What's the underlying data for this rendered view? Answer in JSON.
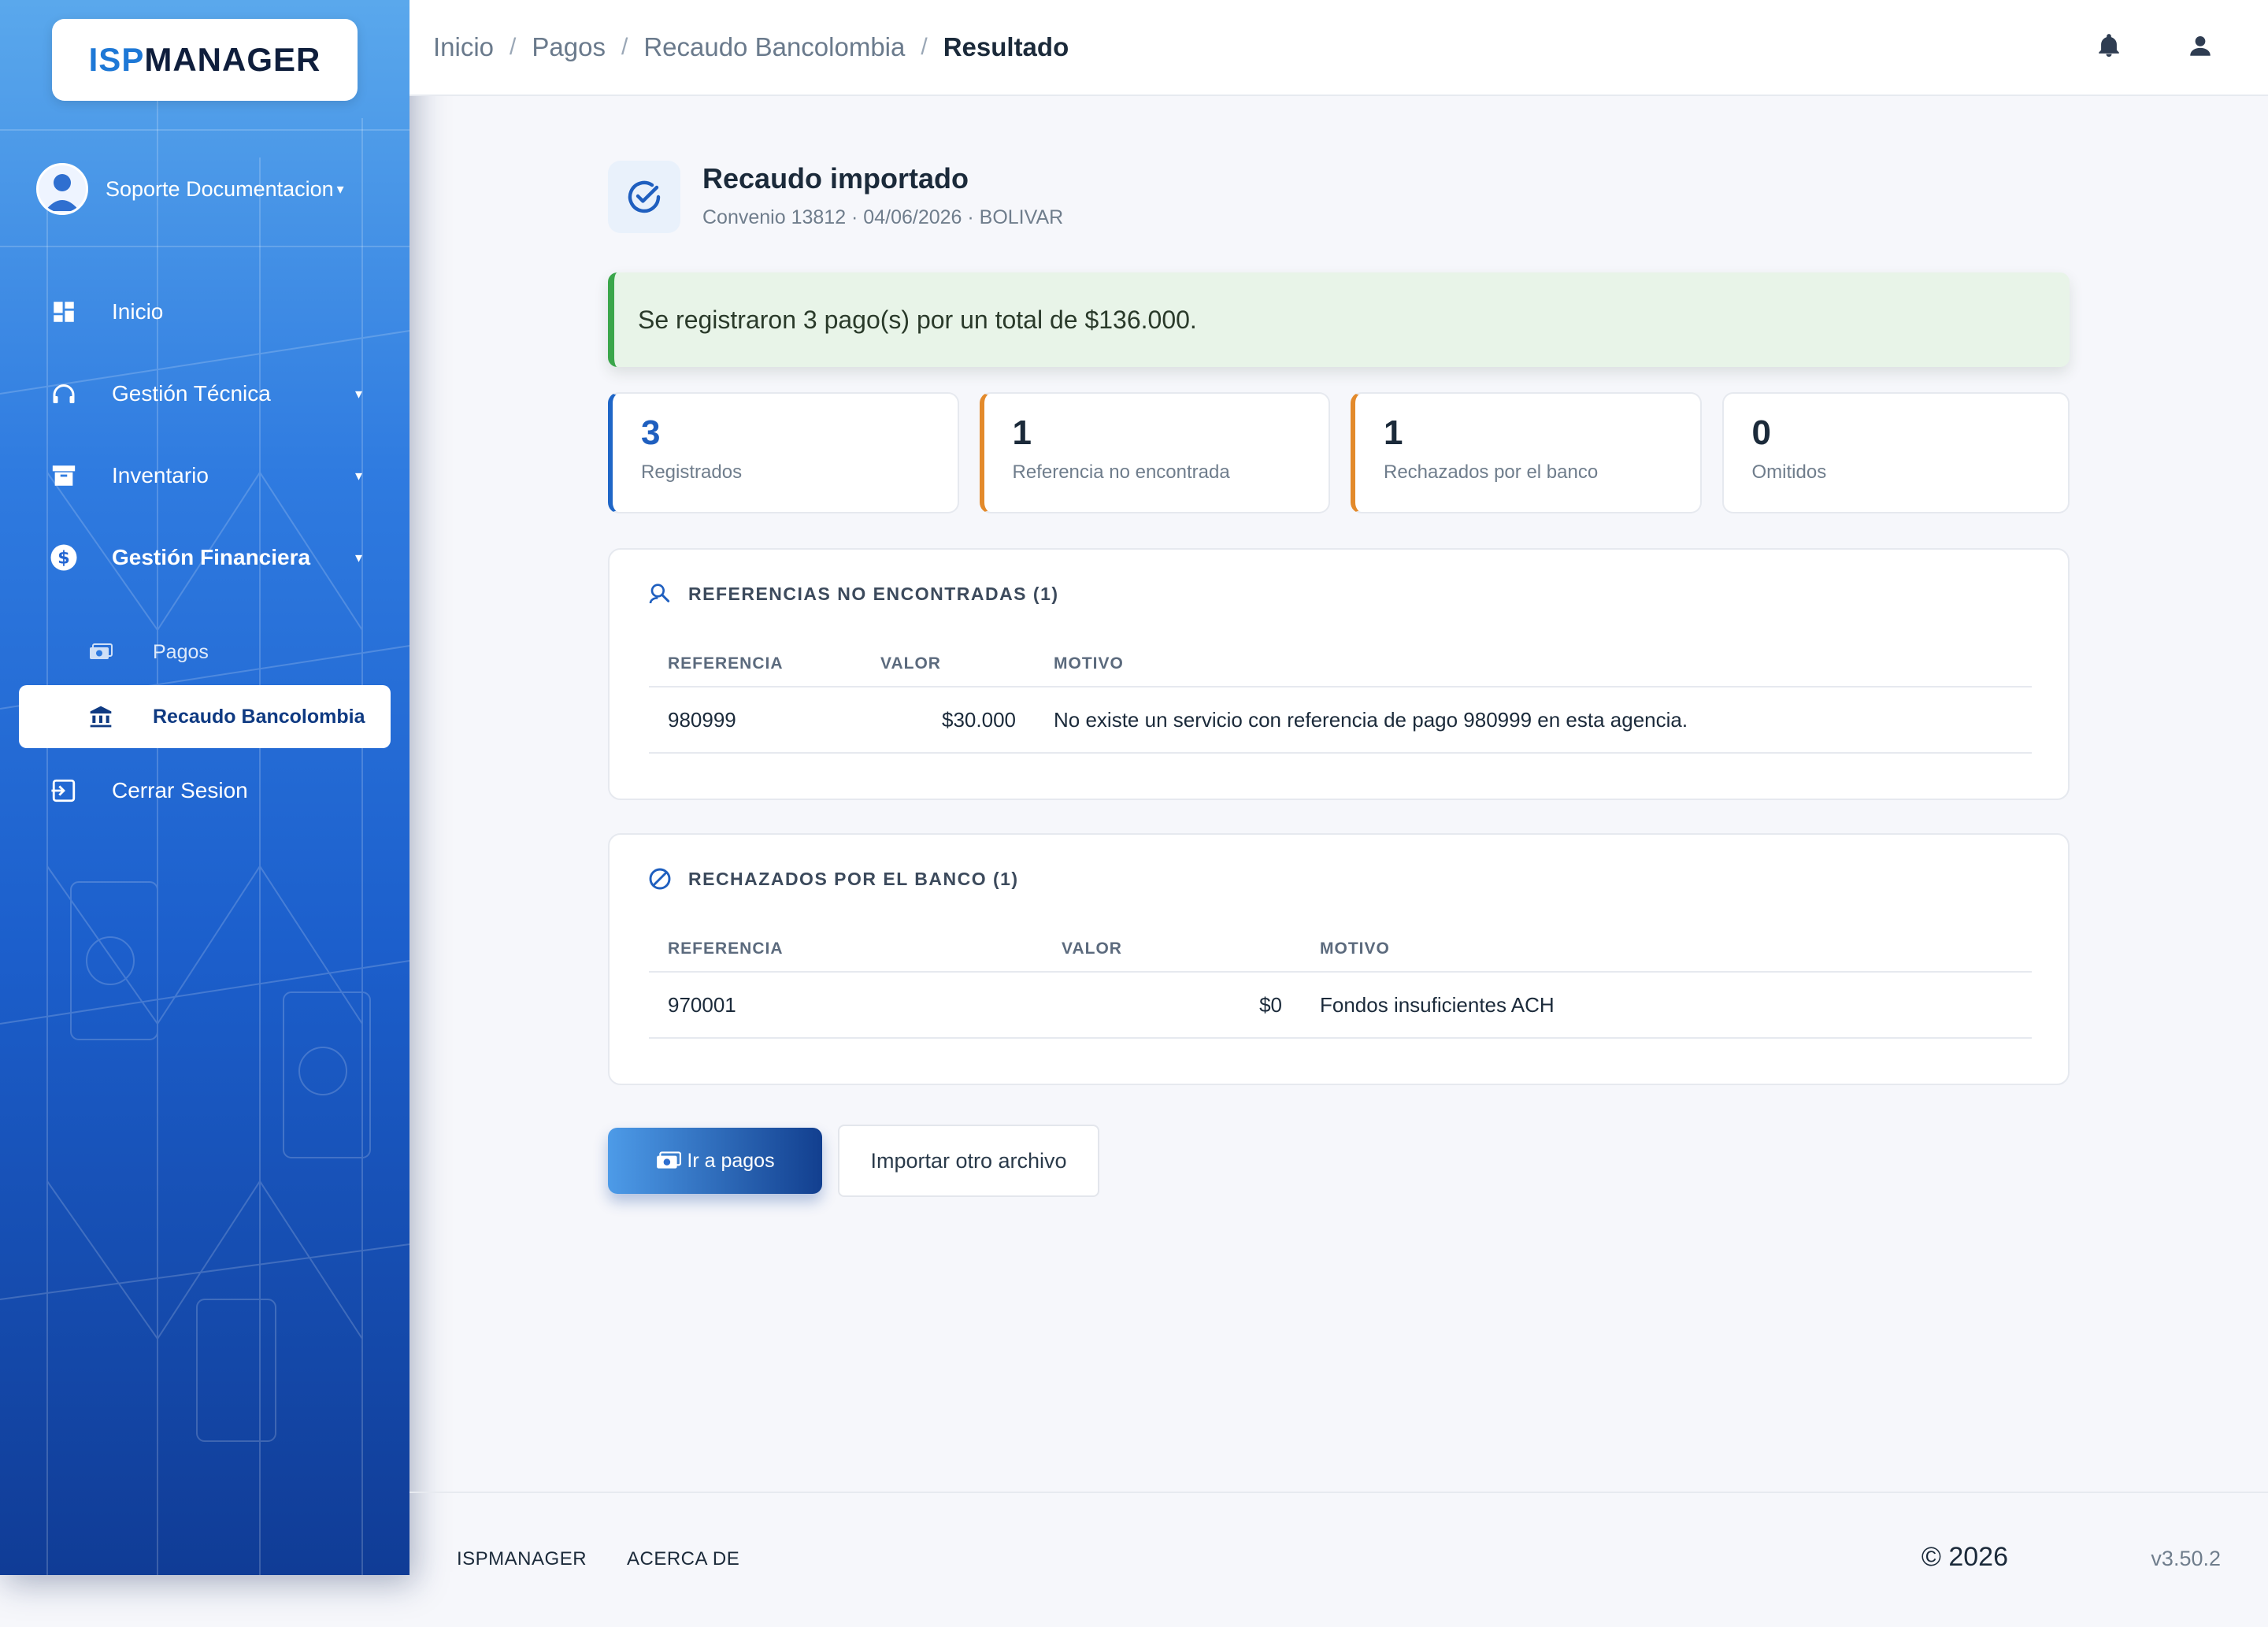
{
  "app": {
    "logo_isp": "ISP",
    "logo_manager": "MANAGER"
  },
  "sidebar": {
    "user_name": "Soporte Documentacion",
    "items": [
      {
        "label": "Inicio",
        "icon": "dashboard-icon"
      },
      {
        "label": "Gestión Técnica",
        "icon": "headset-icon"
      },
      {
        "label": "Inventario",
        "icon": "archive-icon"
      },
      {
        "label": "Gestión Financiera",
        "icon": "dollar-icon"
      }
    ],
    "subitems": [
      {
        "label": "Pagos",
        "icon": "payments-icon"
      },
      {
        "label": "Recaudo Bancolombia",
        "icon": "bank-icon"
      }
    ],
    "logout_label": "Cerrar Sesion"
  },
  "breadcrumb": {
    "items": [
      "Inicio",
      "Pagos",
      "Recaudo Bancolombia"
    ],
    "current": "Resultado",
    "separator": "/"
  },
  "result": {
    "title": "Recaudo importado",
    "subtitle": "Convenio 13812 · 04/06/2026 · BOLIVAR",
    "alert": "Se registraron 3 pago(s) por un total de $136.000."
  },
  "stats": [
    {
      "value": "3",
      "label": "Registrados",
      "accent": "#1f66c7"
    },
    {
      "value": "1",
      "label": "Referencia no encontrada",
      "accent": "#e38a2b"
    },
    {
      "value": "1",
      "label": "Rechazados por el banco",
      "accent": "#e38a2b"
    },
    {
      "value": "0",
      "label": "Omitidos",
      "accent": "#e6e9ef"
    }
  ],
  "not_found": {
    "title": "REFERENCIAS NO ENCONTRADAS (1)",
    "columns": [
      "REFERENCIA",
      "VALOR",
      "MOTIVO"
    ],
    "rows": [
      {
        "referencia": "980999",
        "valor": "$30.000",
        "motivo": "No existe un servicio con referencia de pago 980999 en esta agencia."
      }
    ]
  },
  "rejected": {
    "title": "RECHAZADOS POR EL BANCO (1)",
    "columns": [
      "REFERENCIA",
      "VALOR",
      "MOTIVO"
    ],
    "rows": [
      {
        "referencia": "970001",
        "valor": "$0",
        "motivo": "Fondos insuficientes ACH"
      }
    ]
  },
  "actions": {
    "primary": "Ir a pagos",
    "secondary": "Importar otro archivo"
  },
  "footer": {
    "links": [
      "ISPMANAGER",
      "ACERCA DE"
    ],
    "copyright": "© 2026",
    "version": "v3.50.2"
  },
  "colors": {
    "accent_blue": "#1f66c7",
    "accent_orange": "#e38a2b",
    "success_green": "#3aa64a",
    "sidebar_top": "#5aa8ec",
    "sidebar_bottom": "#103c96"
  }
}
